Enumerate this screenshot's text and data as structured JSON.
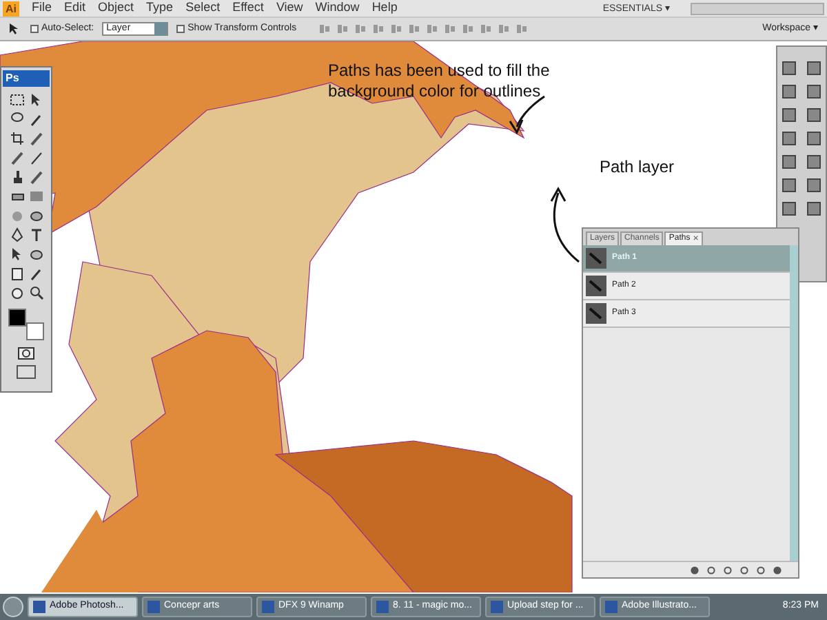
{
  "app_bar": {
    "logo": "Ai",
    "menu": [
      "File",
      "Edit",
      "Object",
      "Type",
      "Select",
      "Effect",
      "View",
      "Window",
      "Help"
    ],
    "workspace_name": "ESSENTIALS ▾"
  },
  "options_bar": {
    "auto_select": {
      "label": "Auto-Select:",
      "checked": false
    },
    "layer_dropdown": "Layer",
    "show_transform": {
      "label": "Show Transform Controls",
      "checked": false
    },
    "workspace": "Workspace ▾"
  },
  "toolbox": {
    "title": "Ps"
  },
  "annotations": [
    {
      "kind": "note",
      "text": "Paths has been used to fill the background color for outlines"
    },
    {
      "kind": "label",
      "text": "Path layer"
    }
  ],
  "paths_panel": {
    "tabs": [
      {
        "label": "Layers",
        "selected": false
      },
      {
        "label": "Channels",
        "selected": false
      },
      {
        "label": "Paths",
        "selected": true
      }
    ],
    "close": "×",
    "rows": [
      {
        "name": "Path 1",
        "selected": true
      },
      {
        "name": "Path 2",
        "selected": false
      },
      {
        "name": "Path 3",
        "selected": false
      }
    ]
  },
  "taskbar": {
    "items": [
      {
        "label": "Adobe Photosh...",
        "selected": true
      },
      {
        "label": "Concepr arts",
        "selected": false
      },
      {
        "label": "DFX 9 Winamp",
        "selected": false
      },
      {
        "label": "8. 11 - magic mo...",
        "selected": false
      },
      {
        "label": "Upload step for ...",
        "selected": false
      },
      {
        "label": "Adobe Illustrato...",
        "selected": false
      }
    ],
    "clock": "8:23 PM"
  }
}
